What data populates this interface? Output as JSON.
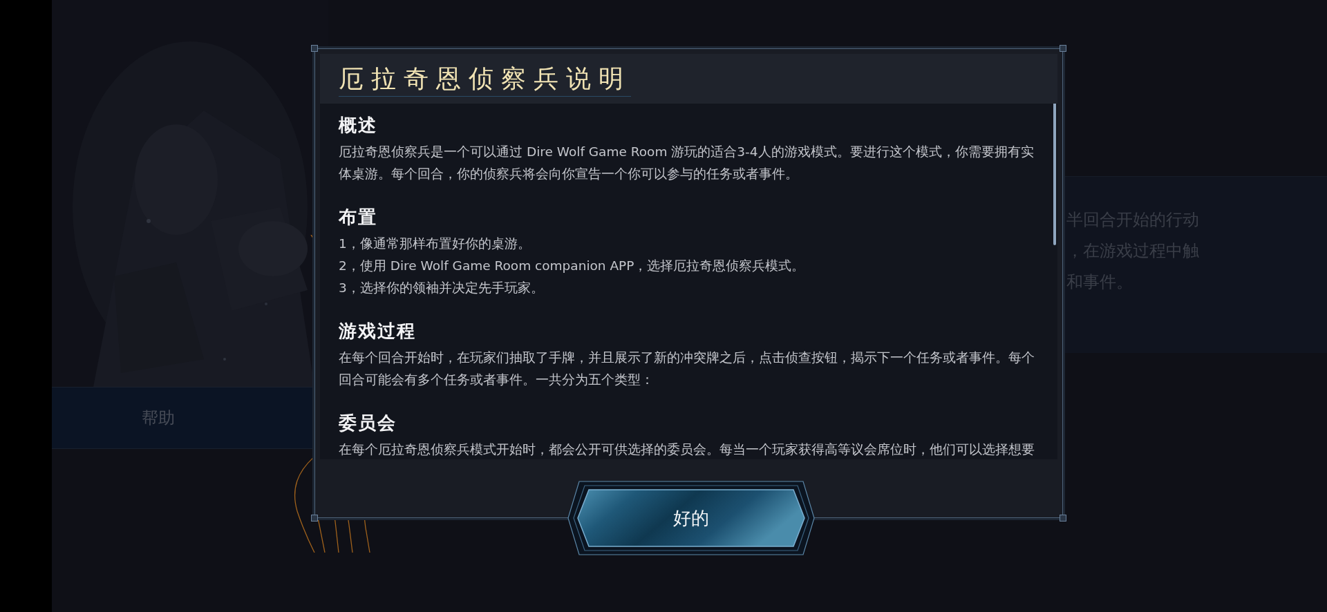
{
  "background": {
    "help_tab": "帮助",
    "side_text": [
      "半回合开始的行动",
      "，在游戏过程中触",
      "和事件。"
    ]
  },
  "dialog": {
    "title": "厄拉奇恩侦察兵说明",
    "sections": [
      {
        "heading": "概述",
        "paragraphs": [
          "厄拉奇恩侦察兵是一个可以通过 Dire Wolf Game Room 游玩的适合3-4人的游戏模式。要进行这个模式，你需要拥有实体桌游。每个回合，你的侦察兵将会向你宣告一个你可以参与的任务或者事件。"
        ]
      },
      {
        "heading": "布置",
        "paragraphs": [
          "1，像通常那样布置好你的桌游。",
          "2，使用 Dire Wolf Game Room companion APP，选择厄拉奇恩侦察兵模式。",
          "3，选择你的领袖并决定先手玩家。"
        ]
      },
      {
        "heading": "游戏过程",
        "paragraphs": [
          "在每个回合开始时，在玩家们抽取了手牌，并且展示了新的冲突牌之后，点击侦查按钮，揭示下一个任务或者事件。每个回合可能会有多个任务或者事件。一共分为五个类型："
        ]
      },
      {
        "heading": "委员会",
        "paragraphs": [
          "在每个厄拉奇恩侦察兵模式开始时，都会公开可供选择的委员会。每当一个玩家获得高等议会席位时，他们可以选择想要"
        ]
      }
    ],
    "confirm_button": "好的"
  }
}
